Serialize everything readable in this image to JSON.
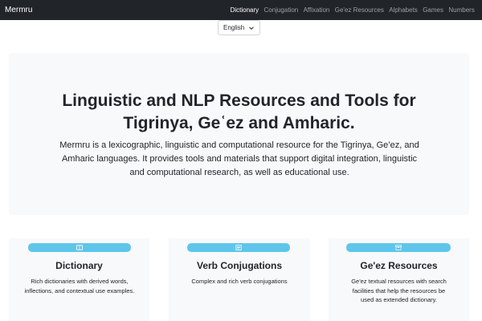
{
  "navbar": {
    "brand": "Mermru",
    "items": [
      {
        "label": "Dictionary",
        "active": true
      },
      {
        "label": "Conjugation",
        "active": false
      },
      {
        "label": "Affixation",
        "active": false
      },
      {
        "label": "Ge'ez Resources",
        "active": false
      },
      {
        "label": "Alphabets",
        "active": false
      },
      {
        "label": "Games",
        "active": false
      },
      {
        "label": "Numbers",
        "active": false
      }
    ]
  },
  "language_select": {
    "value": "English"
  },
  "hero": {
    "title_line1": "Linguistic and NLP Resources and Tools for",
    "title_line2": "Tigrinya, Geʿez and Amharic.",
    "description": "Mermru is a lexicographic, linguistic and computational resource for the Tigrinya, Ge’ez, and Amharic languages. It provides tools and materials that support digital integration, linguistic and computational research, as well as educational use."
  },
  "cards": [
    {
      "icon": "book-icon",
      "title": "Dictionary",
      "text": "Rich dictionaries with derived words, inflections, and contextual use examples."
    },
    {
      "icon": "document-icon",
      "title": "Verb Conjugations",
      "text": "Complex and rich verb conjugations"
    },
    {
      "icon": "archive-icon",
      "title": "Ge'ez Resources",
      "text": "Ge'ez textual resources with search facilities that help the resources be used as extended dictionary."
    }
  ],
  "colors": {
    "navbar_bg": "#212529",
    "card_bar": "#5ec6ea",
    "panel_bg": "#f8f9fa"
  }
}
